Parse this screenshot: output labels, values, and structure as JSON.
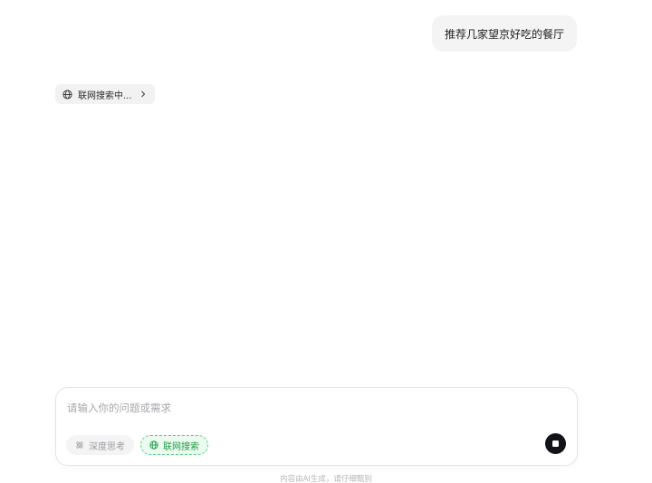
{
  "conversation": {
    "user_message": "推荐几家望京好吃的餐厅",
    "search_status": "联网搜索中..."
  },
  "composer": {
    "placeholder": "请输入你的问题或需求",
    "value": "",
    "deep_think_label": "深度思考",
    "web_search_label": "联网搜索"
  },
  "footer": {
    "disclaimer": "内容由AI生成，请仔细甄别"
  },
  "colors": {
    "web_search_active": "#1f9d45",
    "stop_button": "#111318"
  },
  "icons": {
    "search_status": "globe-icon",
    "expand": "chevron-right-icon",
    "deep_think": "atom-icon",
    "web_search": "globe-icon",
    "stop": "stop-icon"
  }
}
